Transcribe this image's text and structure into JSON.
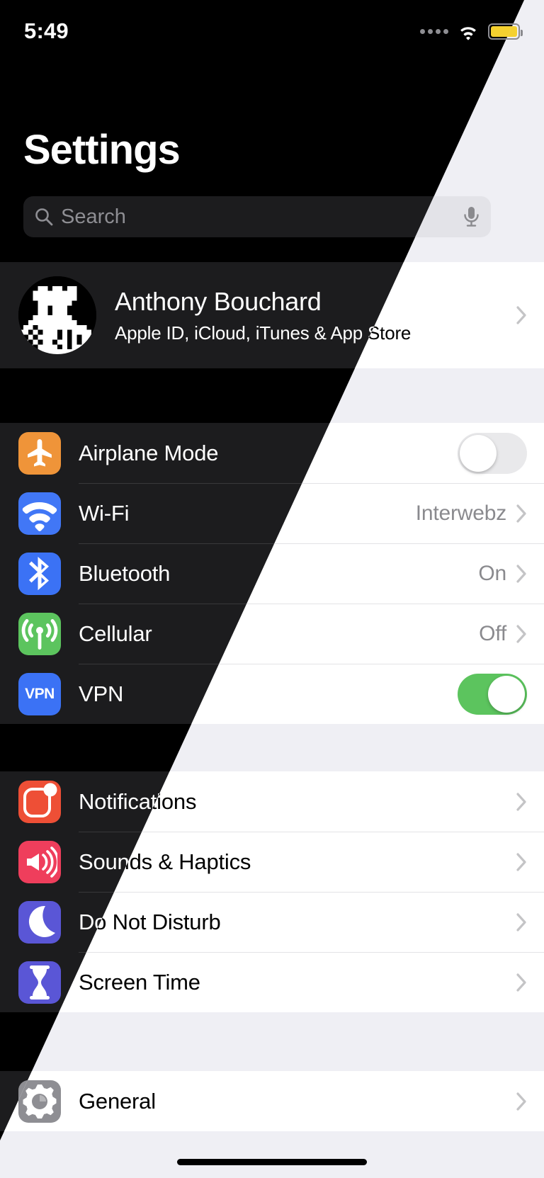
{
  "status_bar": {
    "time": "5:49",
    "signal_icon": "signal-dots-icon",
    "wifi_icon": "wifi-icon",
    "battery_icon": "battery-icon",
    "battery_color": "#f5d130"
  },
  "header": {
    "title": "Settings",
    "search": {
      "placeholder": "Search",
      "value": "",
      "search_icon": "search-icon",
      "mic_icon": "microphone-icon"
    }
  },
  "profile": {
    "name": "Anthony Bouchard",
    "subtitle": "Apple ID, iCloud, iTunes & App Store",
    "avatar_icon": "chess-rook-avatar"
  },
  "groups": [
    {
      "id": "connectivity",
      "rows": [
        {
          "label": "Airplane Mode",
          "icon": "airplane-icon",
          "icon_color": "#ef9439",
          "control": "toggle",
          "toggle_on": false
        },
        {
          "label": "Wi-Fi",
          "icon": "wifi-icon",
          "icon_color": "#4177f6",
          "control": "value",
          "value": "Interwebz"
        },
        {
          "label": "Bluetooth",
          "icon": "bluetooth-icon",
          "icon_color": "#3b72f5",
          "control": "value",
          "value": "On"
        },
        {
          "label": "Cellular",
          "icon": "cellular-antenna-icon",
          "icon_color": "#5cc45e",
          "control": "value",
          "value": "Off"
        },
        {
          "label": "VPN",
          "icon": "vpn-icon",
          "icon_color": "#3b72f5",
          "control": "toggle",
          "toggle_on": true
        }
      ]
    },
    {
      "id": "notifications",
      "rows": [
        {
          "label": "Notifications",
          "icon": "notification-badge-icon",
          "icon_color": "#ee4f36",
          "control": "chevron"
        },
        {
          "label": "Sounds & Haptics",
          "icon": "speaker-icon",
          "icon_color": "#ef3e5c",
          "control": "chevron"
        },
        {
          "label": "Do Not Disturb",
          "icon": "moon-icon",
          "icon_color": "#5a56d6",
          "control": "chevron"
        },
        {
          "label": "Screen Time",
          "icon": "hourglass-icon",
          "icon_color": "#5a56d6",
          "control": "chevron"
        }
      ]
    },
    {
      "id": "general",
      "rows": [
        {
          "label": "General",
          "icon": "gear-icon",
          "icon_color": "#8e8e93",
          "control": "chevron"
        }
      ]
    }
  ],
  "toggle_on_color": "#5cc45e",
  "home_indicator": "home-indicator"
}
